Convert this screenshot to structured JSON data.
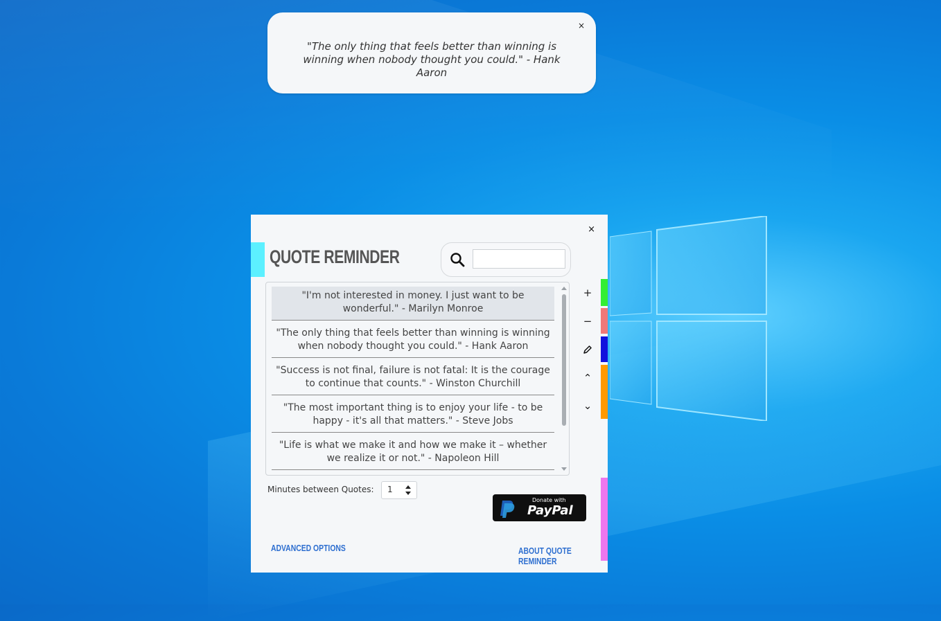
{
  "toast": {
    "close_label": "×",
    "quote": "\"The only thing that feels better than winning is winning when nobody thought you could.\" - Hank Aaron"
  },
  "window": {
    "close_label": "×",
    "title": "QUOTE REMINDER",
    "search": {
      "value": "",
      "placeholder": ""
    },
    "quotes": [
      "\"I'm not interested in money. I just want to be wonderful.\" - Marilyn Monroe",
      "\"The only thing that feels better than winning is winning when nobody thought you could.\" - Hank Aaron",
      "\"Success is not final, failure is not fatal: It is the courage to continue that counts.\" - Winston Churchill",
      "\"The most important thing is to enjoy your life - to be happy - it's all that matters.\" - Steve Jobs",
      "\"Life is what we make it and how we make it – whether we realize it or not.\" - Napoleon Hill"
    ],
    "side_buttons": {
      "add": "+",
      "remove": "−",
      "move_up": "⌃",
      "move_down": "⌄"
    },
    "strip_colors": {
      "add": "#33ee33",
      "remove": "#f07878",
      "edit": "#1111dd",
      "move": "#ff9900",
      "footer": "#ee77ee"
    },
    "title_accent_color": "#5cf0ff",
    "minutes_label": "Minutes between Quotes:",
    "minutes_value": "1",
    "paypal": {
      "small": "Donate with",
      "big": "PayPal"
    },
    "advanced_link": "Advanced Options",
    "about_link": "About Quote Reminder"
  }
}
